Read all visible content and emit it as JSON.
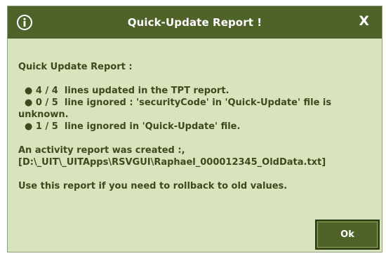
{
  "dialog": {
    "title": "Quick-Update Report !",
    "close_label": "X",
    "heading": "Quick Update Report :",
    "bullets": [
      {
        "prefix": "  ● 4 / 4  ",
        "text": "lines updated in the TPT report."
      },
      {
        "prefix": "  ● 0 / 5  ",
        "text": "line ignored : 'securityCode' in 'Quick-Update' file is"
      },
      {
        "prefix": "",
        "text": "unknown."
      },
      {
        "prefix": "  ● 1 / 5  ",
        "text": "line ignored in 'Quick-Update' file."
      }
    ],
    "activity_line": "An activity report was created :,",
    "activity_path": "[D:\\_UIT\\_UITApps\\RSVGUI\\Raphael_000012345_OldData.txt]",
    "rollback_note": "Use this report if you need to rollback to old values.",
    "ok_label": "Ok"
  },
  "colors": {
    "title_bar": "#4f6228",
    "background": "#d7e4bd",
    "text": "#3d4a1c"
  },
  "icons": {
    "title_icon": "info-icon",
    "close_icon": "close-icon"
  }
}
